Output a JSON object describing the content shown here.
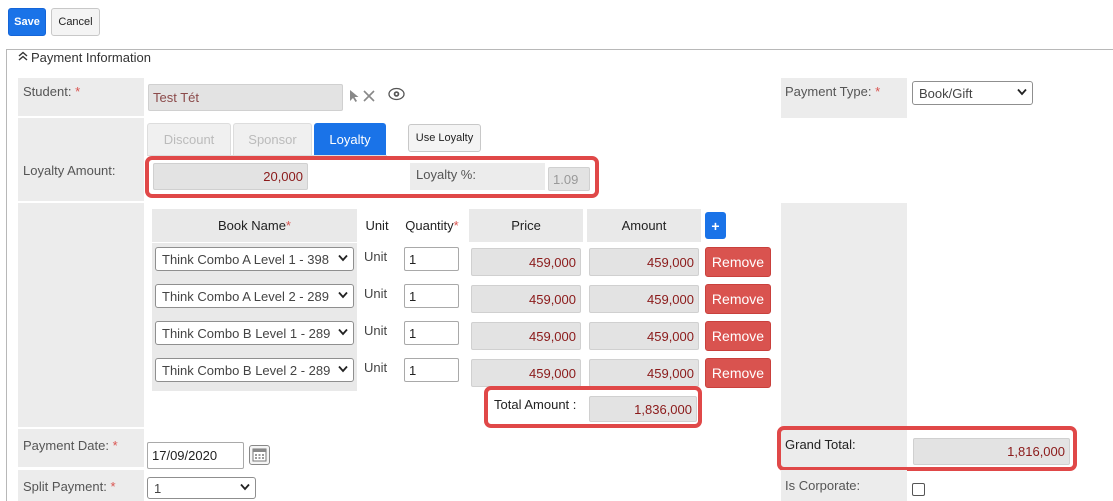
{
  "toolbar": {
    "save_label": "Save",
    "cancel_label": "Cancel"
  },
  "section": {
    "title": "Payment Information"
  },
  "student": {
    "label": "Student:",
    "required_mark": "*",
    "value": "Test Tét"
  },
  "payment_type": {
    "label": "Payment Type:",
    "required_mark": "*",
    "selected": "Book/Gift"
  },
  "tabs": [
    {
      "label": "Discount",
      "active": false
    },
    {
      "label": "Sponsor",
      "active": false
    },
    {
      "label": "Loyalty",
      "active": true
    }
  ],
  "use_loyalty_label": "Use Loyalty",
  "loyalty": {
    "amount_label": "Loyalty Amount:",
    "amount_value": "20,000",
    "percent_label": "Loyalty %:",
    "percent_value": "1.09"
  },
  "books_table": {
    "headers": {
      "book_name": "Book Name",
      "book_name_required": "*",
      "unit": "Unit",
      "quantity": "Quantity",
      "quantity_required": "*",
      "price": "Price",
      "amount": "Amount",
      "add": "+"
    },
    "rows": [
      {
        "book": "Think Combo A Level 1 - 398",
        "unit": "Unit",
        "quantity": "1",
        "price": "459,000",
        "amount": "459,000",
        "remove": "Remove"
      },
      {
        "book": "Think Combo A Level 2 - 289",
        "unit": "Unit",
        "quantity": "1",
        "price": "459,000",
        "amount": "459,000",
        "remove": "Remove"
      },
      {
        "book": "Think Combo B Level 1 - 289",
        "unit": "Unit",
        "quantity": "1",
        "price": "459,000",
        "amount": "459,000",
        "remove": "Remove"
      },
      {
        "book": "Think Combo B Level 2 - 289",
        "unit": "Unit",
        "quantity": "1",
        "price": "459,000",
        "amount": "459,000",
        "remove": "Remove"
      }
    ],
    "total_label": "Total Amount :",
    "total_value": "1,836,000"
  },
  "grand_total": {
    "label": "Grand Total:",
    "value": "1,816,000"
  },
  "payment_date": {
    "label": "Payment Date:",
    "required_mark": "*",
    "value": "17/09/2020"
  },
  "split_payment": {
    "label": "Split Payment:",
    "required_mark": "*",
    "selected": "1"
  },
  "is_corporate": {
    "label": "Is Corporate:",
    "checked": false
  },
  "icons": {
    "section_toggle": "chevron-double-up-icon",
    "select_student": "cursor-icon",
    "clear_student": "close-icon",
    "view_student": "eye-icon",
    "calendar": "calendar-icon"
  },
  "colors": {
    "primary": "#1a73e8",
    "danger": "#d9534f",
    "highlight": "#e04848",
    "value_text": "#8b1a1a"
  }
}
